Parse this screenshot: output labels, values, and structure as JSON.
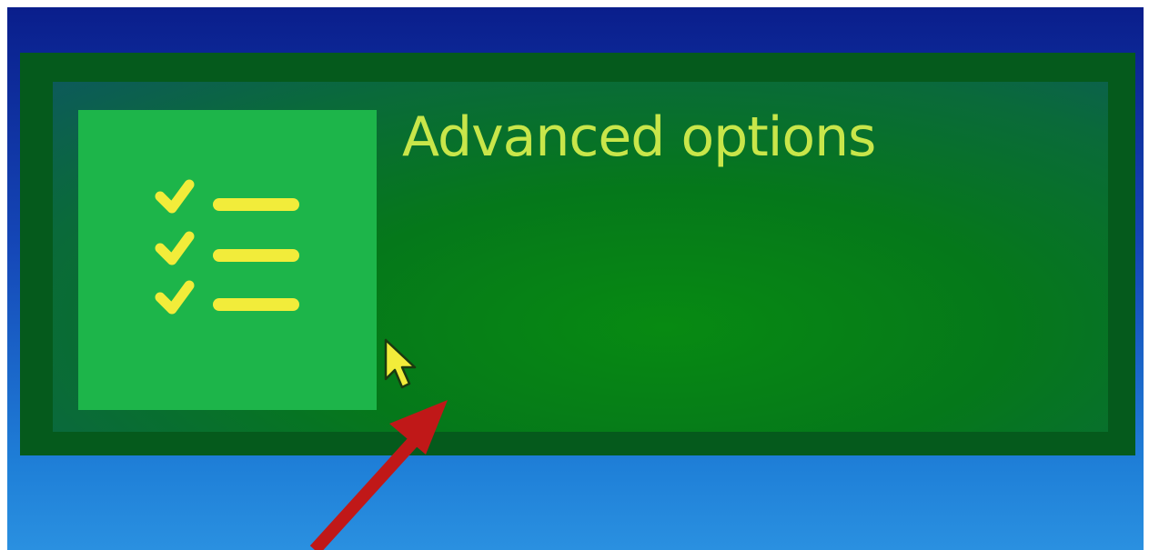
{
  "tile": {
    "title": "Advanced options",
    "icon": "checklist-icon",
    "checklist_items": 3
  },
  "colors": {
    "background_top": "#0a1e8c",
    "background_bottom": "#2a90e0",
    "tile_bg": "#055a1c",
    "icon_box": "#1db54a",
    "accent_yellow": "#f2ec3a",
    "title_text": "#c8e64a",
    "annotation_arrow": "#c01818"
  },
  "annotation": {
    "type": "red-arrow-pointer",
    "target": "advanced-options-tile"
  },
  "cursor": {
    "icon": "mouse-pointer-icon"
  }
}
